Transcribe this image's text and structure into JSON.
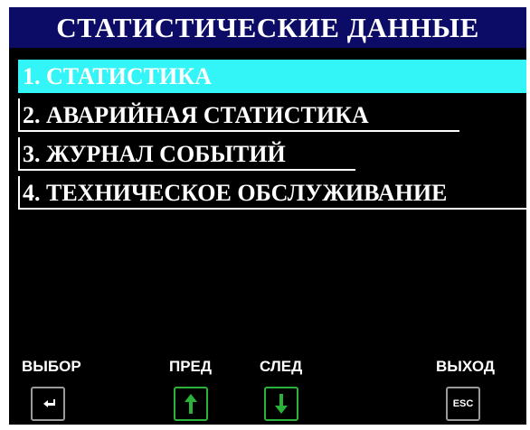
{
  "screen": {
    "title": "СТАТИСТИЧЕСКИЕ ДАННЫЕ"
  },
  "menu": {
    "items": [
      {
        "label": "1. СТАТИСТИКА",
        "selected": true
      },
      {
        "label": "2. АВАРИЙНАЯ СТАТИСТИКА",
        "selected": false
      },
      {
        "label": "3. ЖУРНАЛ СОБЫТИЙ",
        "selected": false
      },
      {
        "label": "4. ТЕХНИЧЕСКОЕ ОБСЛУЖИВАНИЕ",
        "selected": false
      }
    ]
  },
  "softkeys": {
    "select": {
      "label": "ВЫБОР",
      "icon": "enter-icon"
    },
    "prev": {
      "label": "ПРЕД",
      "icon": "arrow-up-icon"
    },
    "next": {
      "label": "СЛЕД",
      "icon": "arrow-down-icon"
    },
    "exit": {
      "label": "ВЫХОД",
      "icon": "esc-icon",
      "key_text": "ESC"
    }
  },
  "colors": {
    "title_bg": "#0c0c66",
    "selected_bg": "#33f4f6",
    "screen_bg": "#000000",
    "nav_button_border": "#2bb23a",
    "button_border": "#9a9a9a"
  }
}
